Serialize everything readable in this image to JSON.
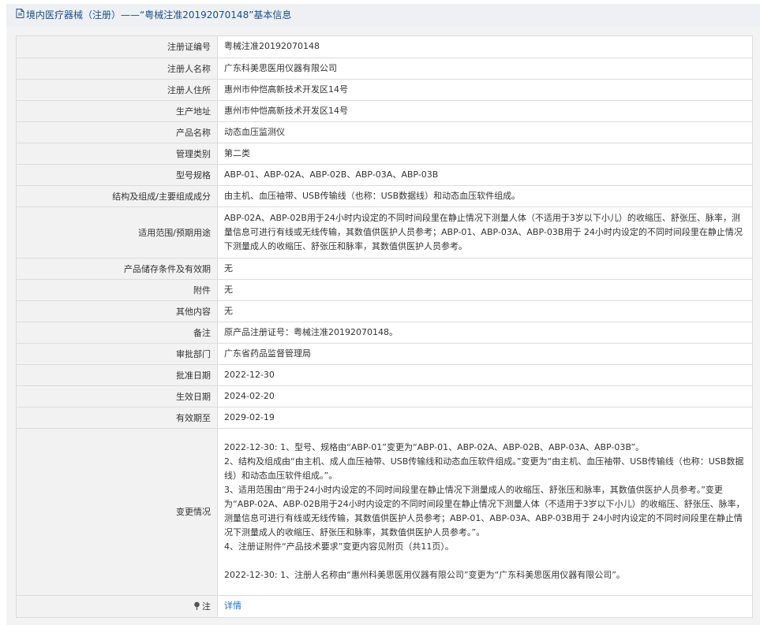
{
  "header": {
    "title": "境内医疗器械（注册）——“粤械注准20192070148”基本信息"
  },
  "rows": [
    {
      "label": "注册证编号",
      "value": "粤械注准20192070148"
    },
    {
      "label": "注册人名称",
      "value": "广东科美思医用仪器有限公司"
    },
    {
      "label": "注册人住所",
      "value": "惠州市仲恺高新技术开发区14号"
    },
    {
      "label": "生产地址",
      "value": "惠州市仲恺高新技术开发区14号"
    },
    {
      "label": "产品名称",
      "value": "动态血压监测仪"
    },
    {
      "label": "管理类别",
      "value": "第二类"
    },
    {
      "label": "型号规格",
      "value": "ABP-01、ABP-02A、ABP-02B、ABP-03A、ABP-03B"
    },
    {
      "label": "结构及组成/主要组成成分",
      "value": "由主机、血压袖带、USB传输线（也称：USB数据线）和动态血压软件组成。"
    },
    {
      "label": "适用范围/预期用途",
      "value": "ABP-02A、ABP-02B用于24小时内设定的不同时间段里在静止情况下测量人体（不适用于3岁以下小儿）的收缩压、舒张压、脉率，测量信息可进行有线或无线传输，其数值供医护人员参考；ABP-01、ABP-03A、ABP-03B用于 24小时内设定的不同时间段里在静止情况下测量成人的收缩压、舒张压和脉率，其数值供医护人员参考。"
    },
    {
      "label": "产品储存条件及有效期",
      "value": "无"
    },
    {
      "label": "附件",
      "value": "无"
    },
    {
      "label": "其他内容",
      "value": "无"
    },
    {
      "label": "备注",
      "value": "原产品注册证号：粤械注准20192070148。"
    },
    {
      "label": "审批部门",
      "value": "广东省药品监督管理局"
    },
    {
      "label": "批准日期",
      "value": "2022-12-30"
    },
    {
      "label": "生效日期",
      "value": "2024-02-20"
    },
    {
      "label": "有效期至",
      "value": "2029-02-19"
    }
  ],
  "changes": {
    "label": "变更情况",
    "paragraphs": [
      "2022-12-30: 1、型号、规格由“ABP-01”变更为“ABP-01、ABP-02A、ABP-02B、ABP-03A、ABP-03B”。",
      "2、结构及组成由“由主机、成人血压袖带、USB传输线和动态血压软件组成。”变更为“由主机、血压袖带、USB传输线（也称：USB数据线）和动态血压软件组成。”。",
      "3、适用范围由“用于24小时内设定的不同时间段里在静止情况下测量成人的收缩压、舒张压和脉率，其数值供医护人员参考。”变更为“ABP-02A、ABP-02B用于24小时内设定的不同时间段里在静止情况下测量人体（不适用于3岁以下小儿）的收缩压、舒张压、脉率，测量信息可进行有线或无线传输，其数值供医护人员参考；ABP-01、ABP-03A、ABP-03B用于 24小时内设定的不同时间段里在静止情况下测量成人的收缩压、舒张压和脉率，其数值供医护人员参考。”。",
      "4、注册证附件“产品技术要求”变更内容见附页（共11页）。",
      "",
      "2022-12-30: 1、注册人名称由“惠州科美思医用仪器有限公司”变更为“广东科美思医用仪器有限公司”。"
    ]
  },
  "note": {
    "label": "注",
    "link": "详情"
  },
  "colors": {
    "header_bg": "#eef0f3",
    "header_text": "#1a4f8a",
    "label_bg": "#f2f2f2",
    "border": "#dcdcdc",
    "link": "#1a6fc4"
  },
  "icons": [
    "document-icon",
    "pin-icon"
  ]
}
